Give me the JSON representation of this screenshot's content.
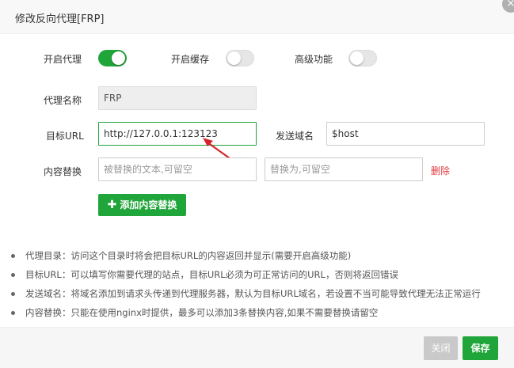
{
  "dialog": {
    "title": "修改反向代理[FRP]",
    "close_icon": "×"
  },
  "toggles": {
    "proxy": {
      "label": "开启代理",
      "on": true
    },
    "cache": {
      "label": "开启缓存",
      "on": false
    },
    "advanced": {
      "label": "高级功能",
      "on": false
    }
  },
  "form": {
    "proxy_name_label": "代理名称",
    "proxy_name_value": "FRP",
    "target_url_label": "目标URL",
    "target_url_value": "http://127.0.0.1:123123",
    "send_domain_label": "发送域名",
    "send_domain_value": "$host",
    "content_replace_label": "内容替换",
    "replace_from_placeholder": "被替换的文本,可留空",
    "replace_to_placeholder": "替换为,可留空",
    "delete_label": "删除",
    "add_replace_label": "添加内容替换"
  },
  "tips": [
    "代理目录：访问这个目录时将会把目标URL的内容返回并显示(需要开启高级功能)",
    "目标URL：可以填写你需要代理的站点，目标URL必须为可正常访问的URL，否则将返回错误",
    "发送域名：将域名添加到请求头传递到代理服务器，默认为目标URL域名，若设置不当可能导致代理无法正常运行",
    "内容替换：只能在使用nginx时提供，最多可以添加3条替换内容,如果不需要替换请留空"
  ],
  "footer": {
    "close_label": "关闭",
    "save_label": "保存"
  },
  "colors": {
    "accent": "#20a53a",
    "danger": "#e2393d"
  }
}
